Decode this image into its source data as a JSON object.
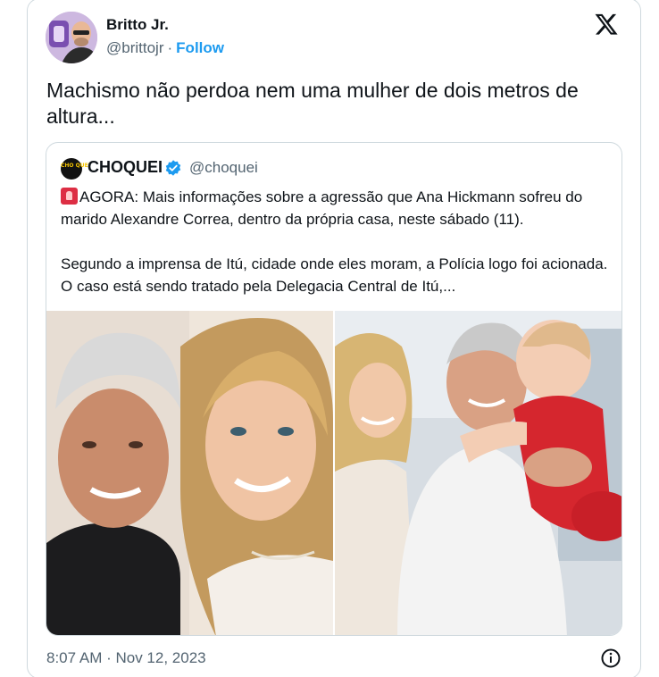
{
  "author": {
    "name": "Britto Jr.",
    "handle": "@brittojr",
    "separator": "·",
    "follow_label": "Follow",
    "avatar_icon": "profile-photo"
  },
  "platform_icon": "x-logo-icon",
  "tweet": {
    "text": "Machismo não perdoa nem uma mulher de dois metros de altura..."
  },
  "quoted": {
    "avatar_text": "CHO QUEI",
    "name": "CHOQUEI",
    "verified_icon": "verified-badge-icon",
    "handle": "@choquei",
    "emoji_icon": "rotating-light-icon",
    "paragraph1": "AGORA: Mais informações sobre a agressão que Ana Hickmann sofreu do marido Alexandre Correa, dentro da própria casa, neste sábado (11).",
    "paragraph2": "Segundo a imprensa de Itú, cidade onde eles moram, a Polícia logo foi acionada. O caso está sendo tratado pela Delegacia Central de Itú,..."
  },
  "footer": {
    "timestamp": "8:07 AM · Nov 12, 2023",
    "info_icon": "info-icon"
  },
  "colors": {
    "link_blue": "#1d9bf0",
    "muted_text": "#536471",
    "border": "#cfd9de",
    "alert_red": "#dd2e44"
  }
}
